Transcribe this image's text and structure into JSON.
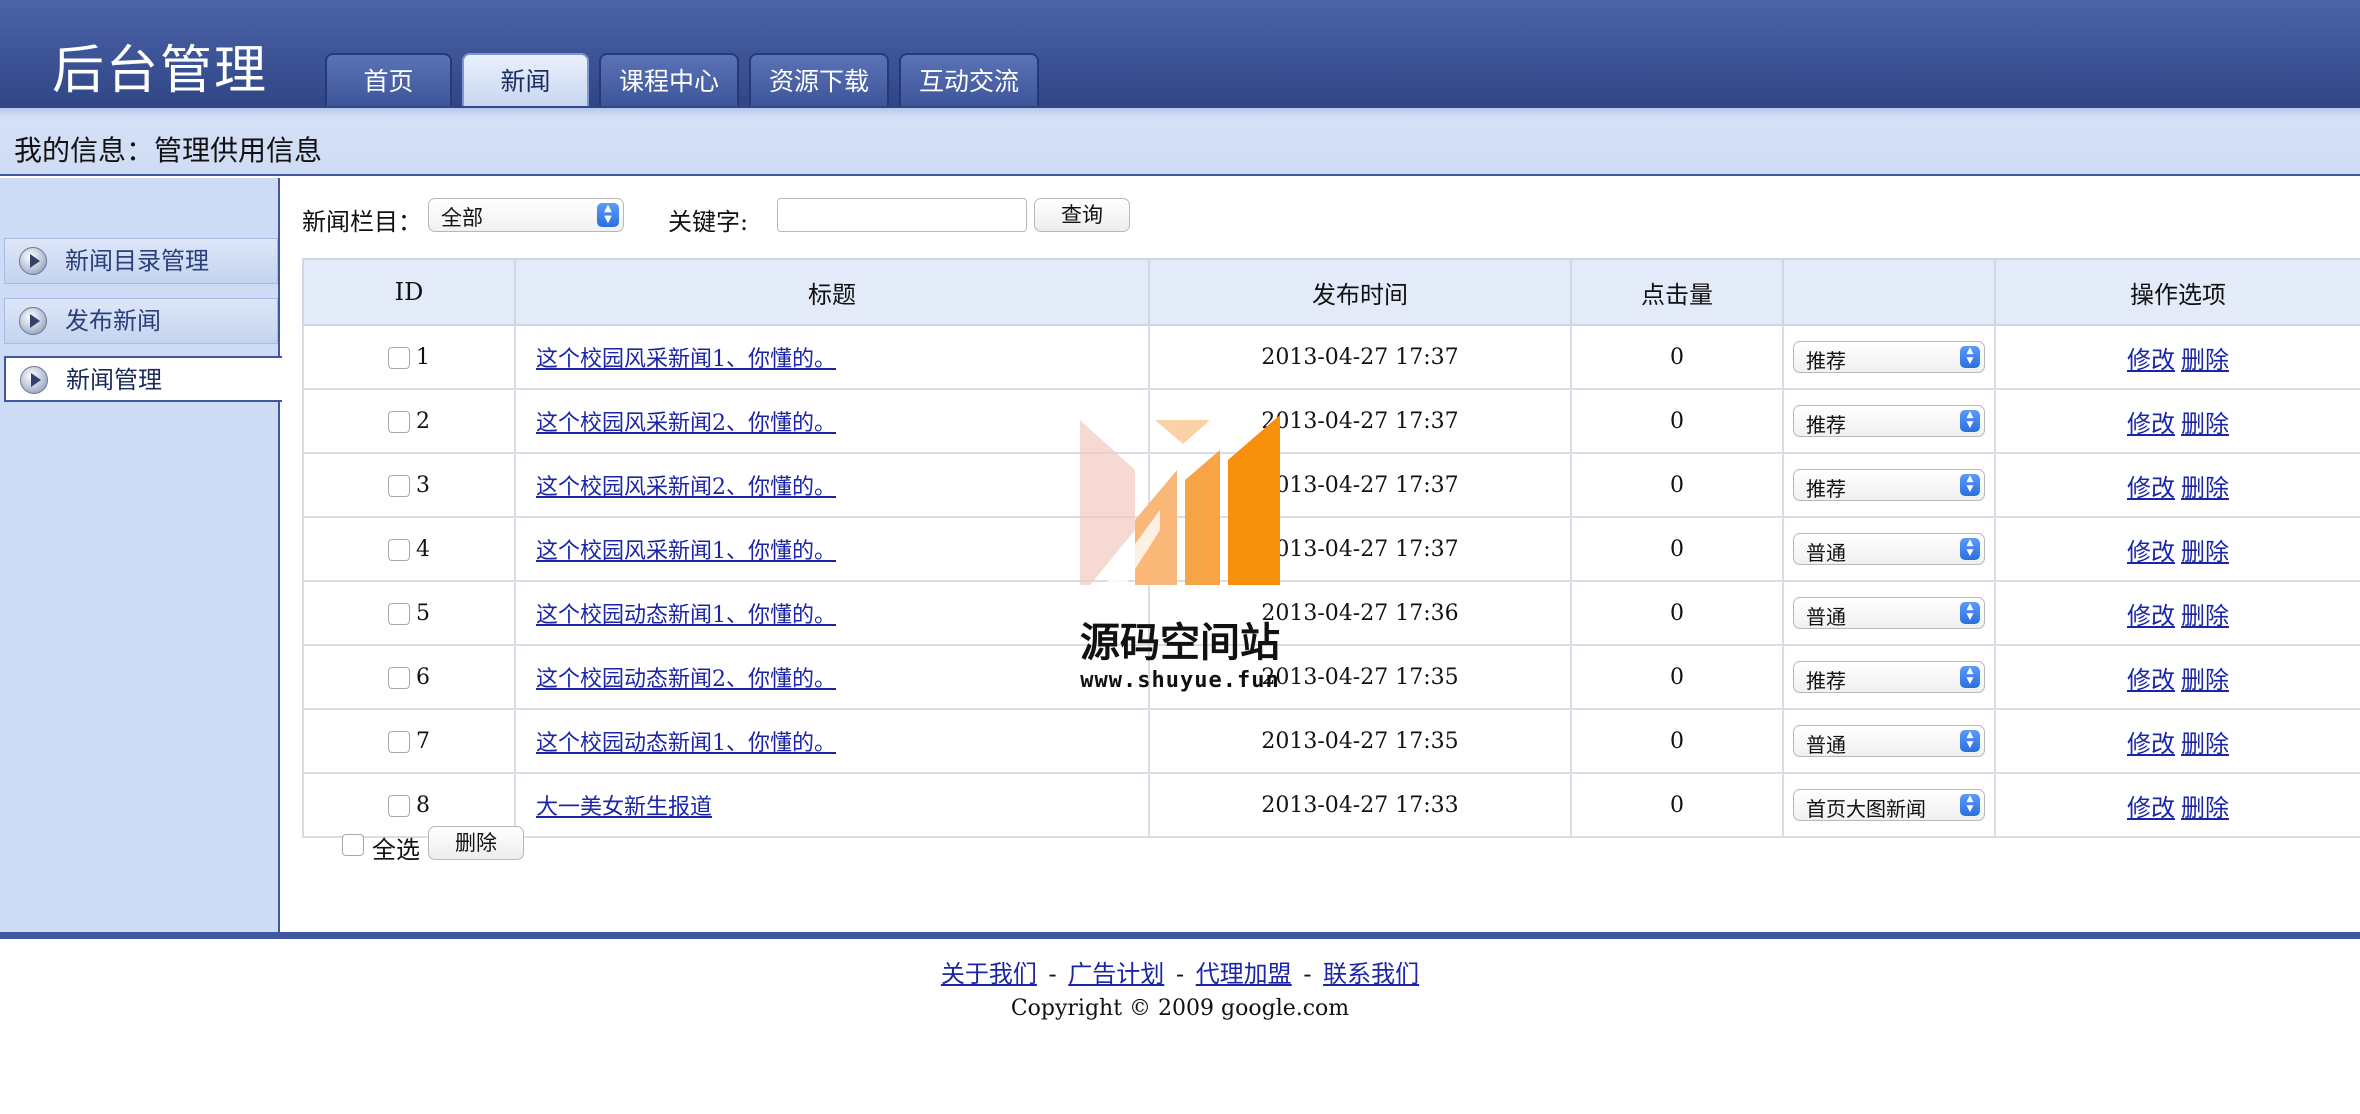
{
  "header": {
    "title": "后台管理",
    "nav": [
      {
        "label": "首页",
        "active": false
      },
      {
        "label": "新闻",
        "active": true
      },
      {
        "label": "课程中心",
        "active": false
      },
      {
        "label": "资源下载",
        "active": false
      },
      {
        "label": "互动交流",
        "active": false
      }
    ]
  },
  "infobar": {
    "text": "我的信息：管理供用信息"
  },
  "sidebar": {
    "items": [
      {
        "label": "新闻目录管理",
        "active": false
      },
      {
        "label": "发布新闻",
        "active": false
      },
      {
        "label": "新闻管理",
        "active": true
      }
    ]
  },
  "filter": {
    "category_label": "新闻栏目：",
    "category_value": "全部",
    "keyword_label": "关键字:",
    "keyword_value": "",
    "search_button": "查询"
  },
  "table": {
    "headers": [
      "ID",
      "标题",
      "发布时间",
      "点击量",
      "",
      "操作选项"
    ],
    "rows": [
      {
        "id": "1",
        "title": "这个校园风采新闻1、你懂的。",
        "time": "2013-04-27 17:37",
        "clicks": "0",
        "status": "推荐"
      },
      {
        "id": "2",
        "title": "这个校园风采新闻2、你懂的。",
        "time": "2013-04-27 17:37",
        "clicks": "0",
        "status": "推荐"
      },
      {
        "id": "3",
        "title": "这个校园风采新闻2、你懂的。",
        "time": "2013-04-27 17:37",
        "clicks": "0",
        "status": "推荐"
      },
      {
        "id": "4",
        "title": "这个校园风采新闻1、你懂的。",
        "time": "2013-04-27 17:37",
        "clicks": "0",
        "status": "普通"
      },
      {
        "id": "5",
        "title": "这个校园动态新闻1、你懂的。",
        "time": "2013-04-27 17:36",
        "clicks": "0",
        "status": "普通"
      },
      {
        "id": "6",
        "title": "这个校园动态新闻2、你懂的。",
        "time": "2013-04-27 17:35",
        "clicks": "0",
        "status": "推荐"
      },
      {
        "id": "7",
        "title": "这个校园动态新闻1、你懂的。",
        "time": "2013-04-27 17:35",
        "clicks": "0",
        "status": "普通"
      },
      {
        "id": "8",
        "title": "大一美女新生报道",
        "time": "2013-04-27 17:33",
        "clicks": "0",
        "status": "首页大图新闻"
      }
    ],
    "edit_label": "修改",
    "delete_label": "删除"
  },
  "bulk": {
    "select_all": "全选",
    "delete_button": "删除"
  },
  "footer": {
    "links": [
      "关于我们",
      "广告计划",
      "代理加盟",
      "联系我们"
    ],
    "separator": "-",
    "copyright": "Copyright © 2009 google.com"
  },
  "watermark": {
    "name": "源码空间站",
    "url": "www.shuyue.fun"
  },
  "colors": {
    "header": "#3c5396",
    "accent_border": "#3f58a0",
    "sidebar_bg": "#cddbf5",
    "link": "#1a25a8",
    "watermark_orange": "#f7900a"
  }
}
